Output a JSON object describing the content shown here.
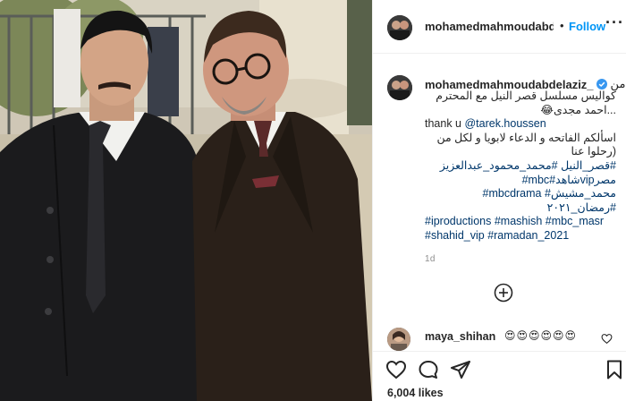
{
  "post": {
    "username": "mohamedmahmoudabdelaziz_",
    "follow_label": "Follow",
    "dot": "•",
    "more": "···",
    "caption": {
      "username": "mohamedmahmoudabdelaziz_",
      "first_word": "من",
      "lines": [
        {
          "text": "كواليس مسلسل قصر النيل مع المحترم",
          "rtl": true,
          "tag": false
        },
        {
          "text": "...احمد مجدى😂",
          "rtl": true,
          "tag": false
        },
        {
          "text": "thank u ",
          "rtl": false,
          "tag": false,
          "mention": "@tarek.houssen"
        },
        {
          "text": "اسألكم الفاتحه و الدعاء لابويا و لكل من",
          "rtl": true,
          "tag": false
        },
        {
          "text": "(رحلوا عنا",
          "rtl": true,
          "tag": false
        },
        {
          "text": "#قصر_النيل #محمد_محمود_عبدالعزيز",
          "rtl": true,
          "tag": true
        },
        {
          "text": "#mbc#شاهدvipمصر",
          "rtl": true,
          "tag": true
        },
        {
          "text": "#mbcdrama #محمد_مشيش",
          "rtl": true,
          "tag": true
        },
        {
          "text": "#رمضان_٢٠٢١",
          "rtl": true,
          "tag": true
        },
        {
          "text": "#iproductions #mashish #mbc_masr",
          "rtl": false,
          "tag": true
        },
        {
          "text": "#shahid_vip #ramadan_2021",
          "rtl": false,
          "tag": true
        }
      ],
      "time": "1d"
    },
    "comment": {
      "username": "maya_shihan",
      "text": "😍😍😍😍😍😍"
    },
    "likes": "6,004 likes"
  },
  "icons": {
    "verified": "verified-badge-icon",
    "load_more": "plus-circle-icon",
    "like": "heart-icon",
    "comment": "comment-bubble-icon",
    "share": "paper-plane-icon",
    "save": "bookmark-icon"
  },
  "colors": {
    "link": "#00376b",
    "follow": "#0095f6",
    "verified": "#3897f0",
    "muted": "#8e8e8e",
    "border": "#efefef"
  }
}
